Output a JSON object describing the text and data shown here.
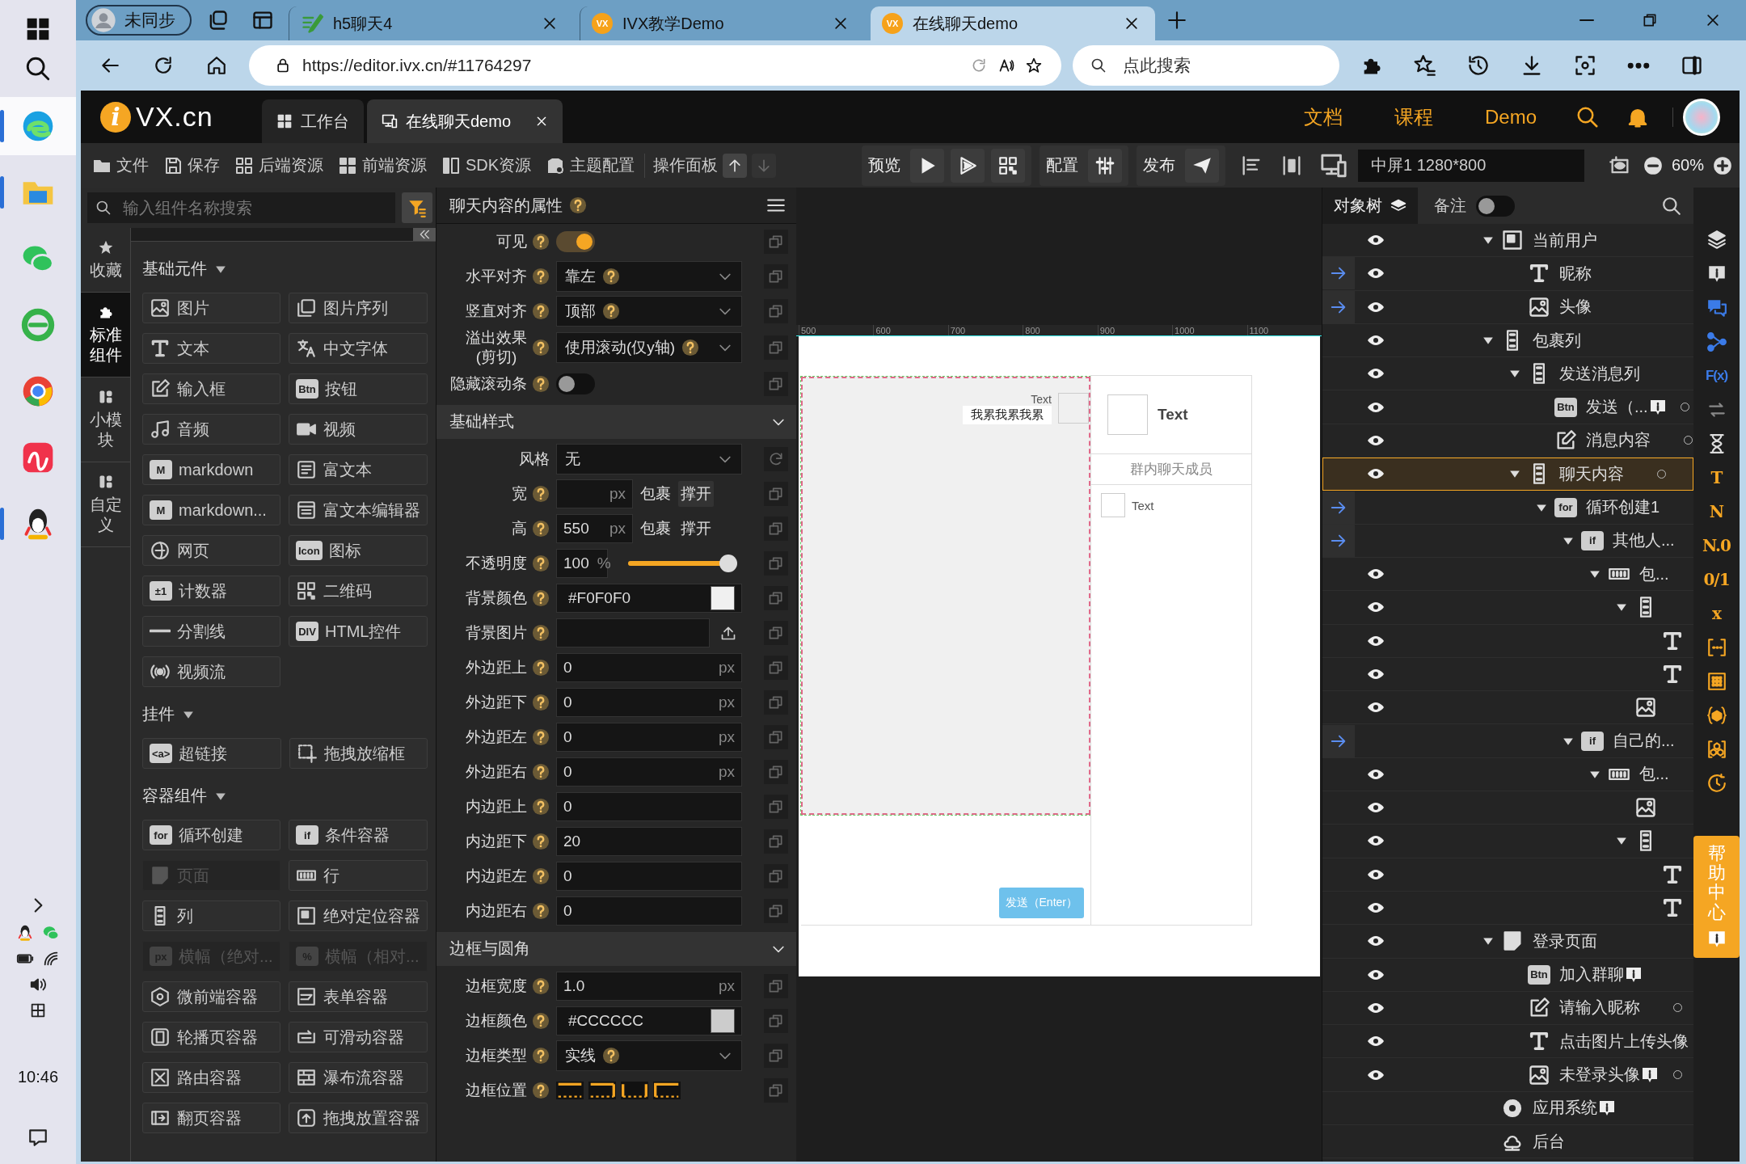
{
  "taskbar": {
    "apps": [
      {
        "selected": true,
        "running": true
      },
      {
        "selected": false,
        "running": true
      },
      {
        "selected": false,
        "running": false
      },
      {
        "selected": false,
        "running": false
      },
      {
        "selected": false,
        "running": false
      },
      {
        "selected": false,
        "running": false
      },
      {
        "selected": false,
        "running": true
      }
    ],
    "time": "10:46"
  },
  "browser": {
    "profile": "未同步",
    "tabs": [
      {
        "title": "h5聊天4",
        "selected": false
      },
      {
        "title": "IVX教学Demo",
        "favicon": "VX",
        "selected": false
      },
      {
        "title": "在线聊天demo",
        "favicon": "VX",
        "selected": true
      }
    ],
    "url": "https://editor.ivx.cn/#11764297",
    "search_placeholder": "点此搜索"
  },
  "header": {
    "logo": {
      "mark": "i",
      "name": "VX.cn"
    },
    "tabs": [
      {
        "label": "工作台",
        "selected": false,
        "closable": false
      },
      {
        "label": "在线聊天demo",
        "selected": true,
        "closable": true
      }
    ],
    "nav": [
      "文档",
      "课程",
      "Demo"
    ]
  },
  "toolbar": {
    "menu": [
      "文件",
      "保存",
      "后端资源",
      "前端资源",
      "SDK资源",
      "主题配置"
    ],
    "panel": "操作面板",
    "preview": "预览",
    "config": "配置",
    "publish": "发布",
    "screen": "中屏1 1280*800",
    "zoom": "60%"
  },
  "palette": {
    "search_placeholder": "输入组件名称搜索",
    "tabs": [
      {
        "label": "收藏",
        "selected": false
      },
      {
        "label": "标准组件",
        "selected": true
      },
      {
        "label": "小模块",
        "selected": false
      },
      {
        "label": "自定义",
        "selected": false
      }
    ],
    "sections": [
      {
        "title": "基础元件",
        "expanded": true,
        "items": [
          {
            "label": "图片",
            "disabled": false
          },
          {
            "label": "图片序列",
            "disabled": false
          },
          {
            "label": "文本",
            "disabled": false
          },
          {
            "label": "中文字体",
            "disabled": false
          },
          {
            "label": "输入框",
            "disabled": false
          },
          {
            "label": "按钮",
            "glyph": "Btn",
            "disabled": false
          },
          {
            "label": "音频",
            "disabled": false
          },
          {
            "label": "视频",
            "disabled": false
          },
          {
            "label": "markdown",
            "glyph": "M",
            "disabled": false
          },
          {
            "label": "富文本",
            "disabled": false
          },
          {
            "label": "markdown...",
            "glyph": "M",
            "disabled": false
          },
          {
            "label": "富文本编辑器",
            "disabled": false
          },
          {
            "label": "网页",
            "disabled": false
          },
          {
            "label": "图标",
            "glyph": "Icon",
            "disabled": false
          },
          {
            "label": "计数器",
            "glyph": "±1",
            "disabled": false
          },
          {
            "label": "二维码",
            "disabled": false
          },
          {
            "label": "分割线",
            "disabled": false
          },
          {
            "label": "HTML控件",
            "glyph": "DIV",
            "disabled": false
          },
          {
            "label": "视频流",
            "disabled": false
          }
        ]
      },
      {
        "title": "挂件",
        "expanded": true,
        "items": [
          {
            "label": "超链接",
            "glyph": "<a>",
            "disabled": false
          },
          {
            "label": "拖拽放缩框",
            "disabled": false
          }
        ]
      },
      {
        "title": "容器组件",
        "expanded": true,
        "items": [
          {
            "label": "循环创建",
            "glyph": "for",
            "disabled": false
          },
          {
            "label": "条件容器",
            "glyph": "if",
            "disabled": false
          },
          {
            "label": "页面",
            "disabled": true
          },
          {
            "label": "行",
            "disabled": false
          },
          {
            "label": "列",
            "disabled": false
          },
          {
            "label": "绝对定位容器",
            "disabled": false
          },
          {
            "label": "横幅（绝对...",
            "glyph": "px",
            "disabled": true
          },
          {
            "label": "横幅（相对...",
            "glyph": "%",
            "disabled": true
          },
          {
            "label": "微前端容器",
            "disabled": false
          },
          {
            "label": "表单容器",
            "disabled": false
          },
          {
            "label": "轮播页容器",
            "disabled": false
          },
          {
            "label": "可滑动容器",
            "disabled": false
          },
          {
            "label": "路由容器",
            "disabled": false
          },
          {
            "label": "瀑布流容器",
            "disabled": false
          },
          {
            "label": "翻页容器",
            "disabled": false
          },
          {
            "label": "拖拽放置容器",
            "disabled": false
          }
        ]
      }
    ]
  },
  "props": {
    "title": "聊天内容的属性",
    "rows": [
      {
        "kind": "toggle",
        "label": "可见",
        "help": true,
        "on": true
      },
      {
        "kind": "select",
        "label": "水平对齐",
        "help": true,
        "value": "靠左",
        "value_help": true
      },
      {
        "kind": "select",
        "label": "竖直对齐",
        "help": true,
        "value": "顶部",
        "value_help": true
      },
      {
        "kind": "select",
        "label": "溢出效果\n(剪切)",
        "help": true,
        "value": "使用滚动(仅y轴)",
        "value_help": true
      },
      {
        "kind": "toggle",
        "label": "隐藏滚动条",
        "help": true,
        "on": false
      }
    ],
    "sections": [
      {
        "title": "基础样式",
        "expanded": true,
        "rows": [
          {
            "kind": "select",
            "label": "风格",
            "help": false,
            "value": "无",
            "value_help": false,
            "resettable": true
          },
          {
            "kind": "size",
            "label": "宽",
            "help": true,
            "unit": "px",
            "options": [
              {
                "label": "包裹",
                "selected": false
              },
              {
                "label": "撑开",
                "selected": true
              }
            ]
          },
          {
            "kind": "size",
            "label": "高",
            "help": true,
            "value": "550",
            "unit": "px",
            "options": [
              {
                "label": "包裹",
                "selected": false
              },
              {
                "label": "撑开",
                "selected": false
              }
            ]
          },
          {
            "kind": "slider",
            "label": "不透明度",
            "help": true,
            "value": "100",
            "unit": "%",
            "level": 1
          },
          {
            "kind": "color",
            "label": "背景颜色",
            "help": true,
            "value": "#F0F0F0"
          },
          {
            "kind": "upload",
            "label": "背景图片",
            "help": true
          },
          {
            "kind": "input",
            "label": "外边距上",
            "help": true,
            "value": "0",
            "unit": "px"
          },
          {
            "kind": "input",
            "label": "外边距下",
            "help": true,
            "value": "0",
            "unit": "px"
          },
          {
            "kind": "input",
            "label": "外边距左",
            "help": true,
            "value": "0",
            "unit": "px"
          },
          {
            "kind": "input",
            "label": "外边距右",
            "help": true,
            "value": "0",
            "unit": "px"
          },
          {
            "kind": "input",
            "label": "内边距上",
            "help": true,
            "value": "0"
          },
          {
            "kind": "input",
            "label": "内边距下",
            "help": true,
            "value": "20"
          },
          {
            "kind": "input",
            "label": "内边距左",
            "help": true,
            "value": "0"
          },
          {
            "kind": "input",
            "label": "内边距右",
            "help": true,
            "value": "0"
          }
        ]
      },
      {
        "title": "边框与圆角",
        "expanded": true,
        "rows": [
          {
            "kind": "input",
            "label": "边框宽度",
            "help": true,
            "value": "1.0",
            "unit": "px"
          },
          {
            "kind": "color",
            "label": "边框颜色",
            "help": true,
            "value": "#CCCCCC"
          },
          {
            "kind": "select",
            "label": "边框类型",
            "help": true,
            "value": "实线",
            "value_help": true
          },
          {
            "kind": "border",
            "label": "边框位置",
            "help": true
          }
        ]
      }
    ]
  },
  "canvas": {
    "ruler": [
      "500",
      "600",
      "700",
      "800",
      "900",
      "1000",
      "1100"
    ],
    "messages": [
      {
        "name": "Text",
        "text": "我累我累我累"
      }
    ],
    "send": "发送（Enter）",
    "user_name": "Text",
    "members_title": "群内聊天成员",
    "members": [
      {
        "name": "Text"
      }
    ]
  },
  "tree": {
    "title": "对象树",
    "notes": {
      "label": "备注",
      "on": false
    },
    "rows": [
      {
        "kind": "container",
        "label": "当前用户",
        "eye": true,
        "linked": false,
        "expanded": true,
        "selected": false,
        "children": [
          {
            "kind": "text",
            "label": "昵称",
            "eye": true,
            "linked": true,
            "selected": false
          },
          {
            "kind": "image",
            "label": "头像",
            "eye": true,
            "linked": true,
            "selected": false
          }
        ]
      },
      {
        "kind": "column",
        "label": "包裹列",
        "eye": true,
        "linked": false,
        "expanded": true,
        "selected": false,
        "children": [
          {
            "kind": "column",
            "label": "发送消息列",
            "eye": true,
            "linked": false,
            "expanded": true,
            "selected": false,
            "children": [
              {
                "kind": "button",
                "glyph": "Btn",
                "label": "发送（...",
                "eye": true,
                "linked": false,
                "info": true,
                "dot": true,
                "selected": false
              },
              {
                "kind": "input",
                "label": "消息内容",
                "eye": true,
                "linked": false,
                "dot": true,
                "selected": false
              }
            ]
          },
          {
            "kind": "column",
            "label": "聊天内容",
            "eye": true,
            "linked": false,
            "expanded": true,
            "dot": true,
            "selected": true,
            "children": [
              {
                "kind": "loop",
                "glyph": "for",
                "label": "循环创建1",
                "eye": false,
                "linked": true,
                "expanded": true,
                "selected": false,
                "children": [
                  {
                    "kind": "condition",
                    "glyph": "if",
                    "label": "其他人...",
                    "eye": false,
                    "linked": true,
                    "expanded": true,
                    "selected": false,
                    "children": [
                      {
                        "kind": "row",
                        "label": "包...",
                        "eye": true,
                        "linked": false,
                        "expanded": true,
                        "selected": false,
                        "children": [
                          {
                            "kind": "column",
                            "eye": true,
                            "linked": false,
                            "expanded": true,
                            "selected": false,
                            "children": [
                              {
                                "kind": "text",
                                "eye": true,
                                "linked": false,
                                "selected": false
                              },
                              {
                                "kind": "text",
                                "eye": true,
                                "linked": false,
                                "selected": false
                              }
                            ]
                          },
                          {
                            "kind": "image",
                            "eye": true,
                            "linked": false,
                            "selected": false
                          }
                        ]
                      }
                    ]
                  },
                  {
                    "kind": "condition",
                    "glyph": "if",
                    "label": "自己的...",
                    "eye": false,
                    "linked": true,
                    "expanded": true,
                    "selected": false,
                    "children": [
                      {
                        "kind": "row",
                        "label": "包...",
                        "eye": true,
                        "linked": false,
                        "expanded": true,
                        "selected": false,
                        "children": [
                          {
                            "kind": "image",
                            "eye": true,
                            "linked": false,
                            "selected": false
                          },
                          {
                            "kind": "column",
                            "eye": true,
                            "linked": false,
                            "expanded": true,
                            "selected": false,
                            "children": [
                              {
                                "kind": "text",
                                "eye": true,
                                "linked": false,
                                "selected": false
                              },
                              {
                                "kind": "text",
                                "eye": true,
                                "linked": false,
                                "selected": false
                              }
                            ]
                          }
                        ]
                      }
                    ]
                  }
                ]
              }
            ]
          }
        ]
      },
      {
        "kind": "page",
        "label": "登录页面",
        "eye": true,
        "linked": false,
        "expanded": true,
        "selected": false,
        "children": [
          {
            "kind": "button",
            "glyph": "Btn",
            "label": "加入群聊",
            "eye": true,
            "linked": false,
            "info": true,
            "selected": false
          },
          {
            "kind": "input",
            "label": "请输入昵称",
            "eye": true,
            "linked": false,
            "dot": true,
            "selected": false
          },
          {
            "kind": "text",
            "label": "点击图片上传头像",
            "eye": true,
            "linked": false,
            "selected": false
          },
          {
            "kind": "image",
            "label": "未登录头像",
            "eye": true,
            "linked": false,
            "info": true,
            "dot": true,
            "selected": false
          }
        ]
      },
      {
        "kind": "system",
        "label": "应用系统",
        "eye": false,
        "linked": false,
        "info": true,
        "selected": false
      },
      {
        "kind": "server",
        "label": "后台",
        "eye": false,
        "linked": false,
        "selected": false
      }
    ]
  },
  "strip": {
    "items": [
      {
        "kind": "icon"
      },
      {
        "kind": "icon"
      },
      {
        "kind": "icon"
      },
      {
        "kind": "icon"
      },
      {
        "kind": "glyph",
        "text": "F(x)"
      },
      {
        "kind": "icon"
      },
      {
        "kind": "icon"
      },
      {
        "kind": "glyph",
        "text": "T"
      },
      {
        "kind": "glyph",
        "text": "N"
      },
      {
        "kind": "glyph",
        "text": "N.0"
      },
      {
        "kind": "glyph",
        "text": "0/1"
      },
      {
        "kind": "glyph",
        "text": "x"
      },
      {
        "kind": "icon"
      },
      {
        "kind": "icon"
      },
      {
        "kind": "icon"
      },
      {
        "kind": "icon"
      },
      {
        "kind": "icon"
      }
    ],
    "help": "帮助中心"
  }
}
